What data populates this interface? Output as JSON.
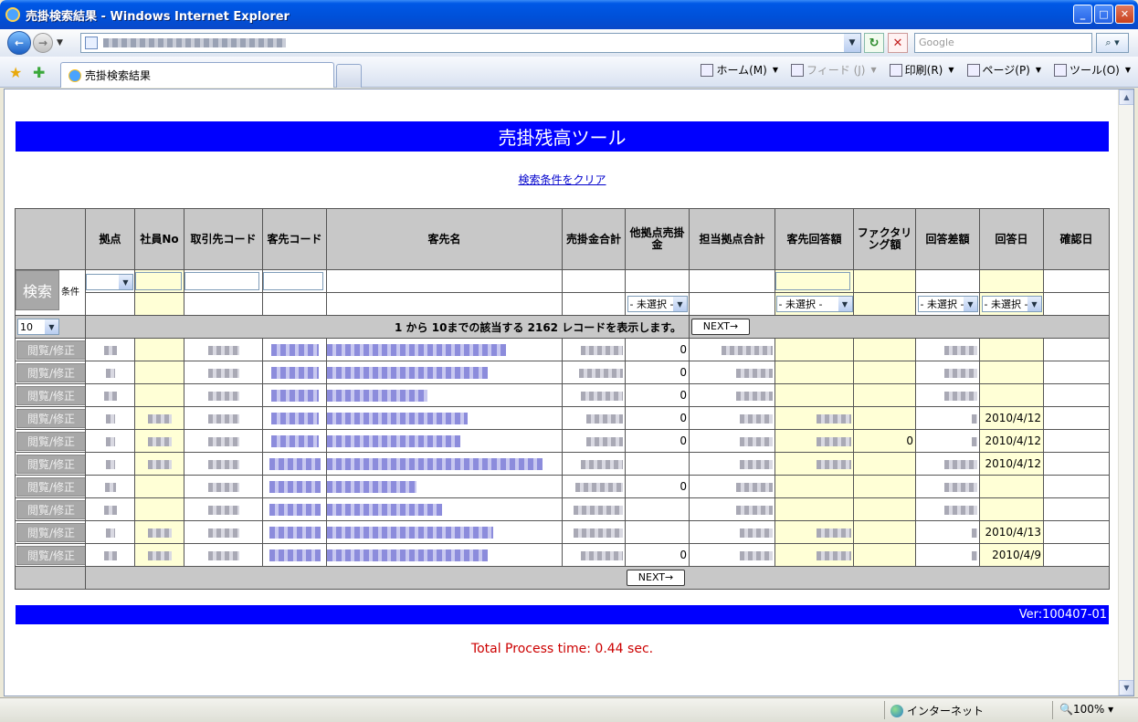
{
  "window": {
    "title": "売掛検索結果 - Windows Internet Explorer"
  },
  "browser": {
    "search_placeholder": "Google",
    "tab_title": "売掛検索結果",
    "commands": {
      "home": "ホーム(M)",
      "feed": "フィード (J)",
      "print": "印刷(R)",
      "page": "ページ(P)",
      "tools": "ツール(O)"
    }
  },
  "page": {
    "header": "売掛残高ツール",
    "clear_link": "検索条件をクリア",
    "columns": [
      "拠点",
      "社員No",
      "取引先コード",
      "客先コード",
      "客先名",
      "売掛金合計",
      "他拠点売掛金",
      "担当拠点合計",
      "客先回答額",
      "ファクタリング額",
      "回答差額",
      "回答日",
      "確認日"
    ],
    "search": {
      "button": "検索",
      "condition_label": "条件",
      "unselected": "- 未選択 -"
    },
    "pager": {
      "page_size": "10",
      "summary": "1 から 10までの該当する 2162 レコードを表示します。",
      "next": "NEXT→"
    },
    "edit_label": "閲覧/修正",
    "rows": [
      {
        "other": "0",
        "factoring": "",
        "answer_date": ""
      },
      {
        "other": "0",
        "factoring": "",
        "answer_date": ""
      },
      {
        "other": "0",
        "factoring": "",
        "answer_date": ""
      },
      {
        "other": "0",
        "factoring": "",
        "answer_date": "2010/4/12"
      },
      {
        "other": "0",
        "factoring": "0",
        "answer_date": "2010/4/12"
      },
      {
        "other": "",
        "factoring": "",
        "answer_date": "2010/4/12"
      },
      {
        "other": "0",
        "factoring": "",
        "answer_date": ""
      },
      {
        "other": "",
        "factoring": "",
        "answer_date": ""
      },
      {
        "other": "",
        "factoring": "",
        "answer_date": "2010/4/13"
      },
      {
        "other": "0",
        "factoring": "",
        "answer_date": "2010/4/9"
      }
    ],
    "version": "Ver:100407-01",
    "process_time": "Total Process time: 0.44 sec."
  },
  "status": {
    "zone": "インターネット",
    "zoom": "100%"
  }
}
